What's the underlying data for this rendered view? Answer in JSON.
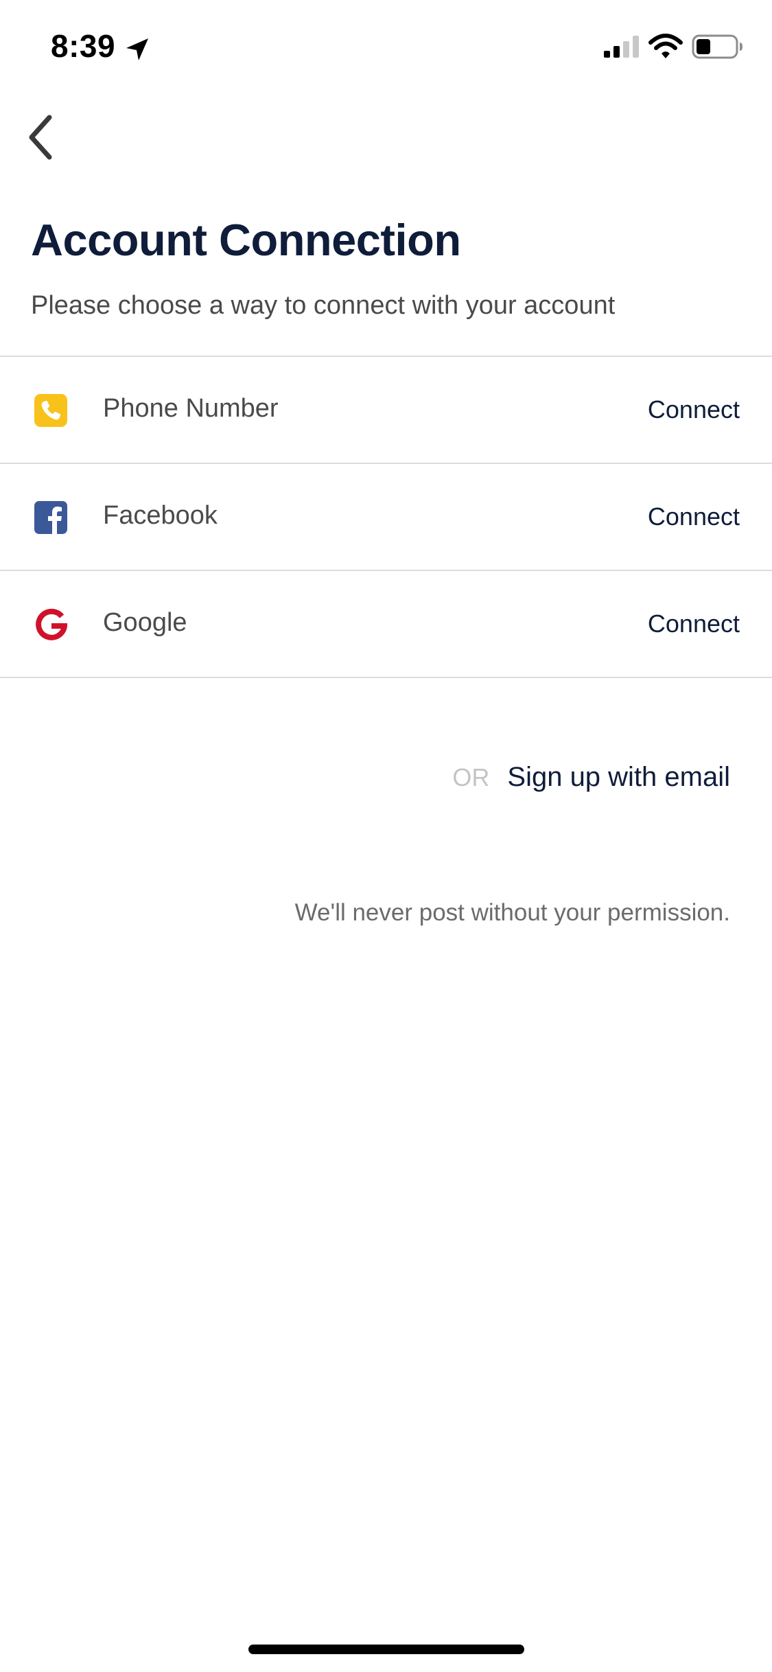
{
  "status_bar": {
    "time": "8:39",
    "icons": [
      "location-arrow-icon",
      "cellular-signal-icon",
      "wifi-icon",
      "battery-icon"
    ]
  },
  "nav": {
    "back_icon": "chevron-left-icon"
  },
  "header": {
    "title": "Account Connection",
    "subtitle": "Please choose a way to connect with your account"
  },
  "connections": [
    {
      "label": "Phone Number",
      "action": "Connect",
      "icon": "phone-icon",
      "color": "#F8C21B"
    },
    {
      "label": "Facebook",
      "action": "Connect",
      "icon": "facebook-icon",
      "color": "#3B5998"
    },
    {
      "label": "Google",
      "action": "Connect",
      "icon": "google-icon",
      "color": "#D0112B"
    }
  ],
  "alternative": {
    "or_label": "OR",
    "email_link": "Sign up with email"
  },
  "footer": {
    "note": "We'll never post without your permission."
  },
  "colors": {
    "primary_text": "#0F1D3A",
    "secondary_text": "#4A4A4A",
    "divider": "#DCDCDC",
    "muted": "#C4C4C4"
  }
}
